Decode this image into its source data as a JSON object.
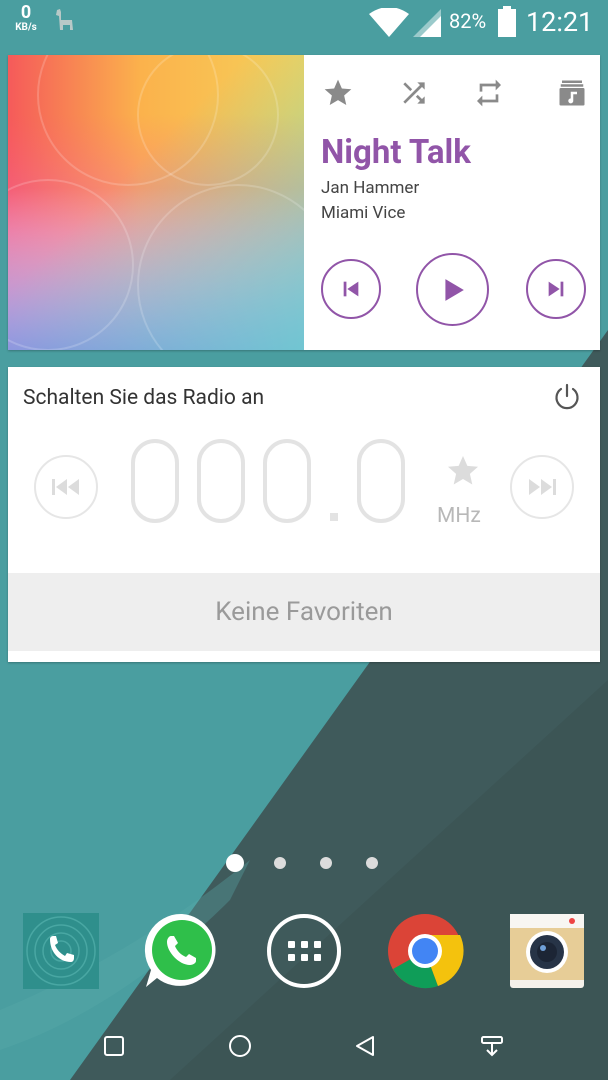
{
  "status_bar": {
    "net_speed_value": "0",
    "net_speed_unit": "KB/s",
    "notification_icon": "llama-icon",
    "wifi_icon": "wifi-icon",
    "signal_icon": "signal-icon",
    "battery_percent": "82%",
    "battery_icon": "battery-icon",
    "time": "12:21"
  },
  "music_widget": {
    "controls_top": [
      "star-icon",
      "shuffle-icon",
      "repeat-icon",
      "playlist-icon"
    ],
    "track_title": "Night Talk",
    "artist": "Jan Hammer",
    "album": "Miami Vice",
    "playback": [
      "previous-icon",
      "play-icon",
      "next-icon"
    ],
    "accent_color": "#9155a8"
  },
  "radio_widget": {
    "title": "Schalten Sie das Radio an",
    "frequency": "000.0",
    "unit": "MHz",
    "favorites_text": "Keine Favoriten",
    "icons": [
      "power-icon",
      "seek-back-icon",
      "favorite-star-icon",
      "seek-forward-icon"
    ]
  },
  "home_pages": {
    "count": 4,
    "active": 1
  },
  "dock": [
    "phone-app-icon",
    "whatsapp-app-icon",
    "app-drawer-icon",
    "chrome-app-icon",
    "camera-app-icon"
  ],
  "nav_bar": [
    "recent-apps-icon",
    "home-icon",
    "back-icon",
    "notification-pull-icon"
  ],
  "colors": {
    "wallpaper_teal": "#4a9ea0",
    "wallpaper_dark": "#3d5657"
  }
}
